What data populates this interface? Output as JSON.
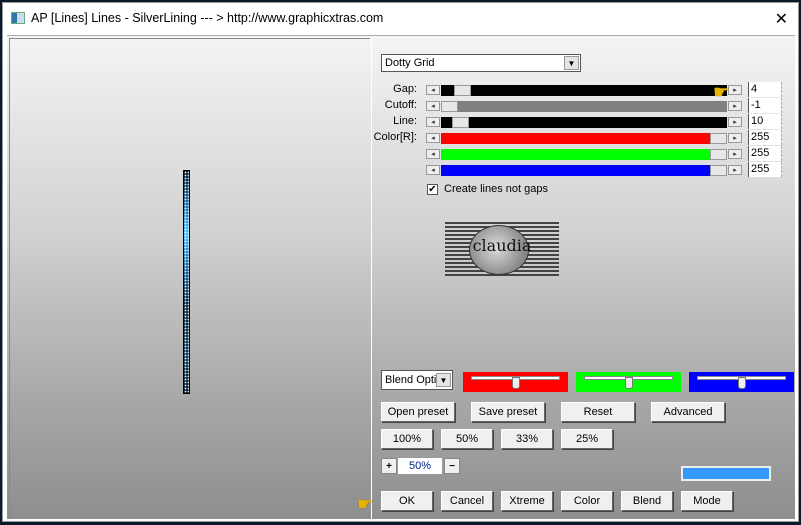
{
  "window": {
    "title": "AP [Lines]  Lines - SilverLining    --- > http://www.graphicxtras.com",
    "close_glyph": "✕"
  },
  "preset_dropdown": {
    "value": "Dotty Grid",
    "arrow": "▼"
  },
  "sliders": [
    {
      "label": "Gap:",
      "value": "4",
      "position": 0.05,
      "fill": "#000000"
    },
    {
      "label": "Cutoff:",
      "value": "-1",
      "position": 0.0,
      "fill": "#808080"
    },
    {
      "label": "Line:",
      "value": "10",
      "position": 0.04,
      "fill": "#000000"
    },
    {
      "label": "Color[R]:",
      "value": "255",
      "position": 1.0,
      "fill": "#ff0000"
    },
    {
      "label": "",
      "value": "255",
      "position": 1.0,
      "fill": "#00ff00"
    },
    {
      "label": "",
      "value": "255",
      "position": 1.0,
      "fill": "#0000ff"
    }
  ],
  "slider_arrows": {
    "left": "◂",
    "right": "▸"
  },
  "checkbox": {
    "label": "Create lines not gaps",
    "checked": true,
    "mark": "✔"
  },
  "logo": {
    "text": "claudia"
  },
  "blend_dropdown": {
    "value": "Blend Optio",
    "arrow": "▼"
  },
  "color_bars": [
    {
      "color": "#ff0000",
      "position": 0.5
    },
    {
      "color": "#00ff00",
      "position": 0.5
    },
    {
      "color": "#0000ff",
      "position": 0.5
    }
  ],
  "buttons_row1": [
    "Open preset",
    "Save preset",
    "Reset",
    "Advanced"
  ],
  "buttons_row2": [
    "100%",
    "50%",
    "33%",
    "25%"
  ],
  "zoom": {
    "plus": "+",
    "value": "50%",
    "minus": "−"
  },
  "swatch_color": "#3399ff",
  "buttons_row3": [
    "OK",
    "Cancel",
    "Xtreme",
    "Color",
    "Blend",
    "Mode"
  ],
  "pointer_glyph": "☛"
}
